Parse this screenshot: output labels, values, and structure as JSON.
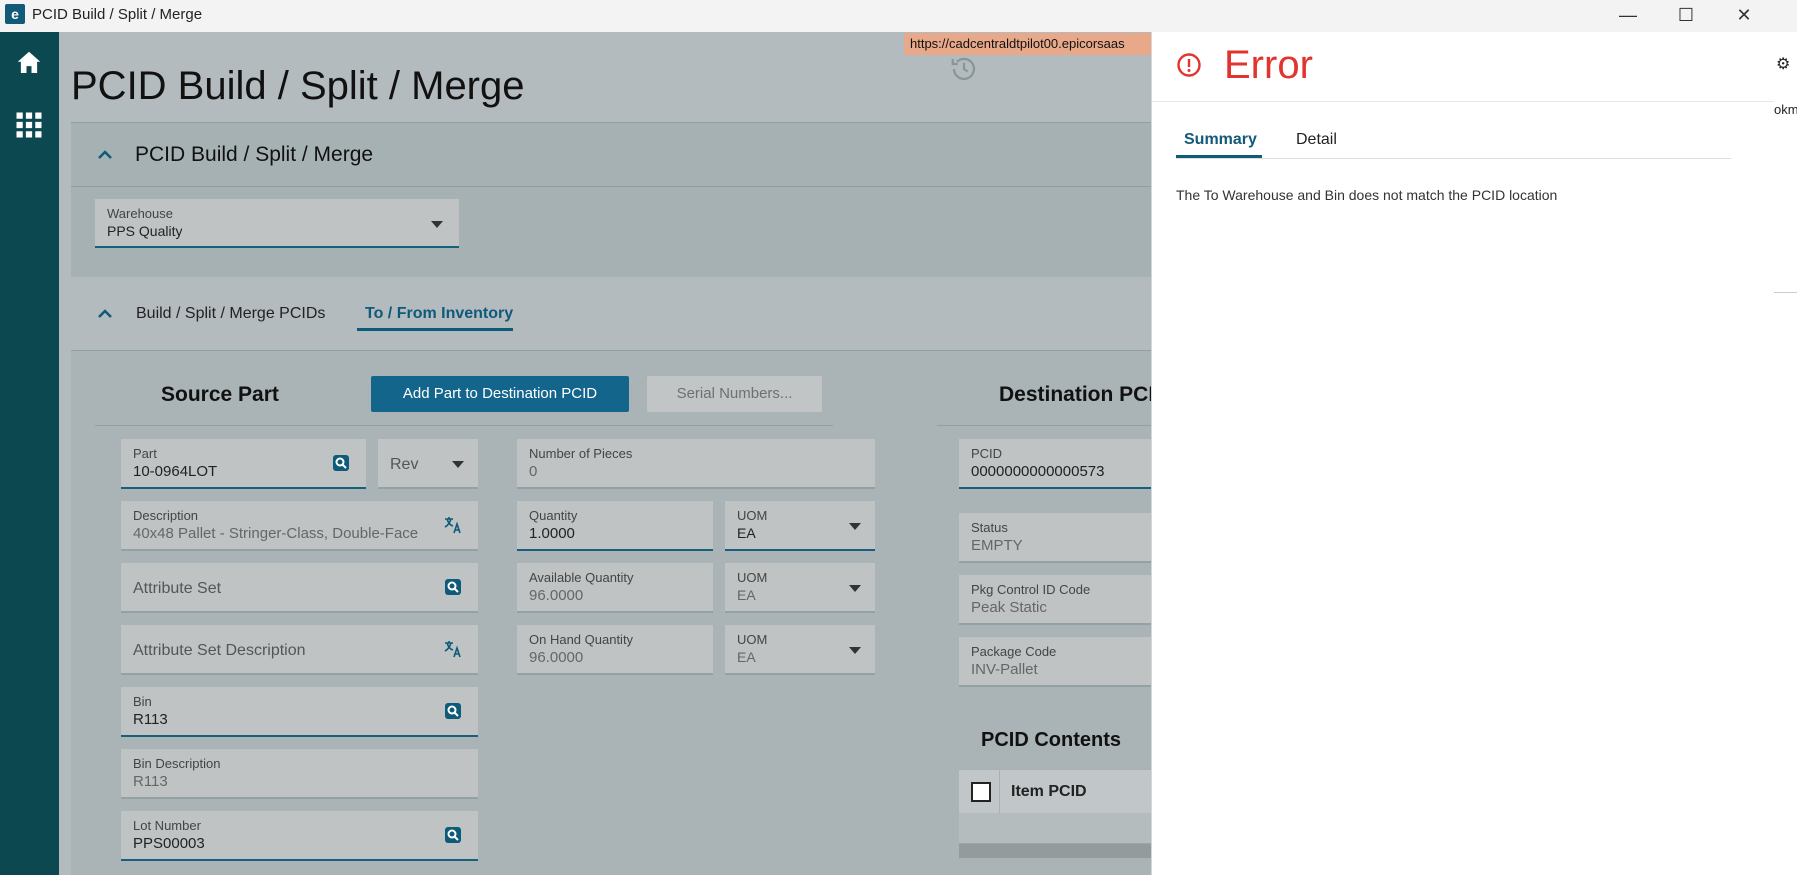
{
  "window": {
    "title": "PCID Build / Split / Merge",
    "app_logo": "e",
    "minimize_glyph": "—",
    "maximize_glyph": "☐",
    "close_glyph": "✕"
  },
  "nav": {
    "items": [
      {
        "icon": "home-icon"
      },
      {
        "icon": "apps-grid-icon"
      }
    ]
  },
  "browser": {
    "url": "https://cadcentraldtpilot00.epicorsaas"
  },
  "page": {
    "title": "PCID Build / Split / Merge"
  },
  "header_card": {
    "title": "PCID Build / Split / Merge",
    "warehouse": {
      "label": "Warehouse",
      "value": "PPS Quality"
    }
  },
  "tabs": [
    {
      "label": "Build / Split / Merge PCIDs",
      "selected": false
    },
    {
      "label": "To / From Inventory",
      "selected": true
    }
  ],
  "source": {
    "title": "Source Part",
    "add_button": "Add Part to Destination PCID",
    "serial_button": "Serial Numbers...",
    "part": {
      "label": "Part",
      "value": "10-0964LOT"
    },
    "rev": {
      "placeholder": "Rev"
    },
    "description": {
      "label": "Description",
      "value": "40x48 Pallet - Stringer-Class, Double-Face"
    },
    "attribute_set": {
      "placeholder": "Attribute Set"
    },
    "attribute_set_description": {
      "placeholder": "Attribute Set Description"
    },
    "bin": {
      "label": "Bin",
      "value": "R113"
    },
    "bin_description": {
      "label": "Bin Description",
      "value": "R113"
    },
    "lot_number": {
      "label": "Lot Number",
      "value": "PPS00003"
    },
    "number_of_pieces": {
      "label": "Number of Pieces",
      "value": "0"
    },
    "quantity": {
      "label": "Quantity",
      "value": "1.0000"
    },
    "quantity_uom": {
      "label": "UOM",
      "value": "EA"
    },
    "available_quantity": {
      "label": "Available Quantity",
      "value": "96.0000"
    },
    "available_uom": {
      "label": "UOM",
      "value": "EA"
    },
    "on_hand_quantity": {
      "label": "On Hand Quantity",
      "value": "96.0000"
    },
    "on_hand_uom": {
      "label": "UOM",
      "value": "EA"
    }
  },
  "destination": {
    "title": "Destination PCII",
    "pcid": {
      "label": "PCID",
      "value": "0000000000000573"
    },
    "status": {
      "label": "Status",
      "value": "EMPTY"
    },
    "pkg_control_id_code": {
      "label": "Pkg Control ID Code",
      "value": "Peak Static"
    },
    "package_code": {
      "label": "Package Code",
      "value": "INV-Pallet"
    },
    "contents_title": "PCID Contents",
    "grid_header": "Item PCID"
  },
  "error_pane": {
    "title": "Error",
    "tabs": [
      {
        "label": "Summary",
        "selected": true
      },
      {
        "label": "Detail",
        "selected": false
      }
    ],
    "message": "The To Warehouse and Bin does not match the PCID location"
  },
  "right_peek": {
    "text": "okm"
  },
  "colors": {
    "nav_bg": "#0b4850",
    "primary": "#13658c",
    "error": "#e2342f",
    "overlay": "#b4bbbe"
  }
}
